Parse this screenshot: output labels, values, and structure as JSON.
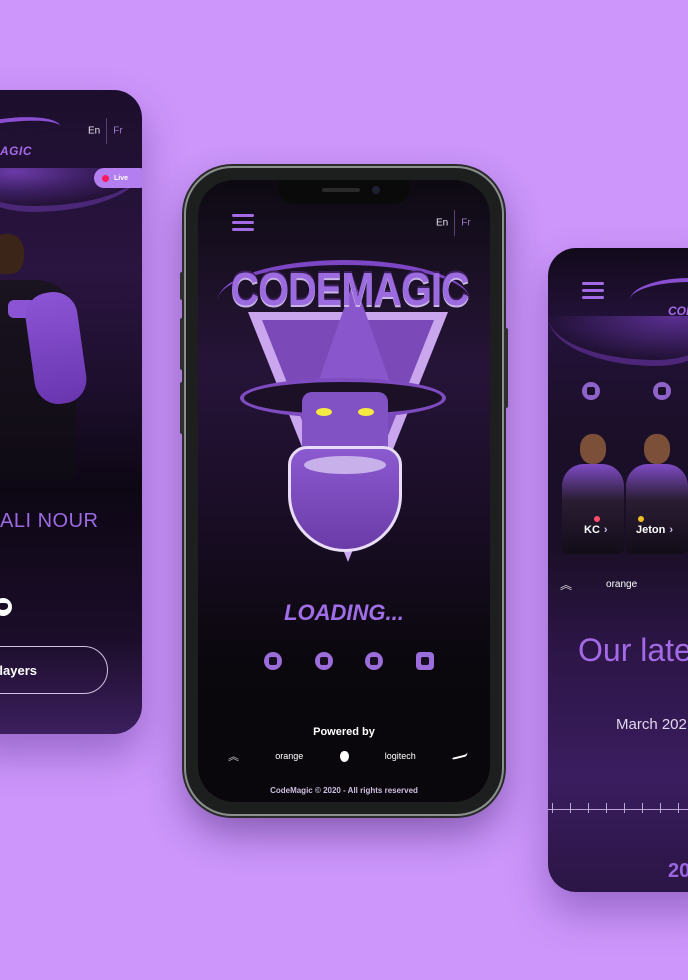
{
  "colors": {
    "background": "#cc96fb",
    "accent": "#a46ae6",
    "live_dot": "#ff1a5e"
  },
  "left_phone": {
    "lang_en": "En",
    "lang_fr": "Fr",
    "logo_text": "AGIC",
    "live_label": "Live",
    "player_name": "ALI NOUR",
    "social_icon": "discord-icon",
    "players_button": "Players"
  },
  "center_phone": {
    "menu_icon": "hamburger-menu-icon",
    "lang_en": "En",
    "lang_fr": "Fr",
    "logo_title": "CODEMAGIC",
    "loading_text": "LOADING...",
    "socials": [
      "youtube-icon",
      "instagram-icon",
      "twitter-icon",
      "discord-icon"
    ],
    "powered_by": "Powered by",
    "sponsors": {
      "orange": "orange",
      "apple": "apple-icon",
      "logitech": "logitech",
      "nike": "nike-icon"
    },
    "copyright": "CodeMagic © 2020 -  All rights reserved"
  },
  "right_phone": {
    "menu_icon": "hamburger-menu-icon",
    "logo_text": "CODE",
    "socials": [
      "youtube-icon",
      "instagram-icon"
    ],
    "players": [
      {
        "name": "KC"
      },
      {
        "name": "Jeton"
      }
    ],
    "sponsor_orange": "orange",
    "heading": "Our late",
    "date": "March 202",
    "year": "20"
  }
}
